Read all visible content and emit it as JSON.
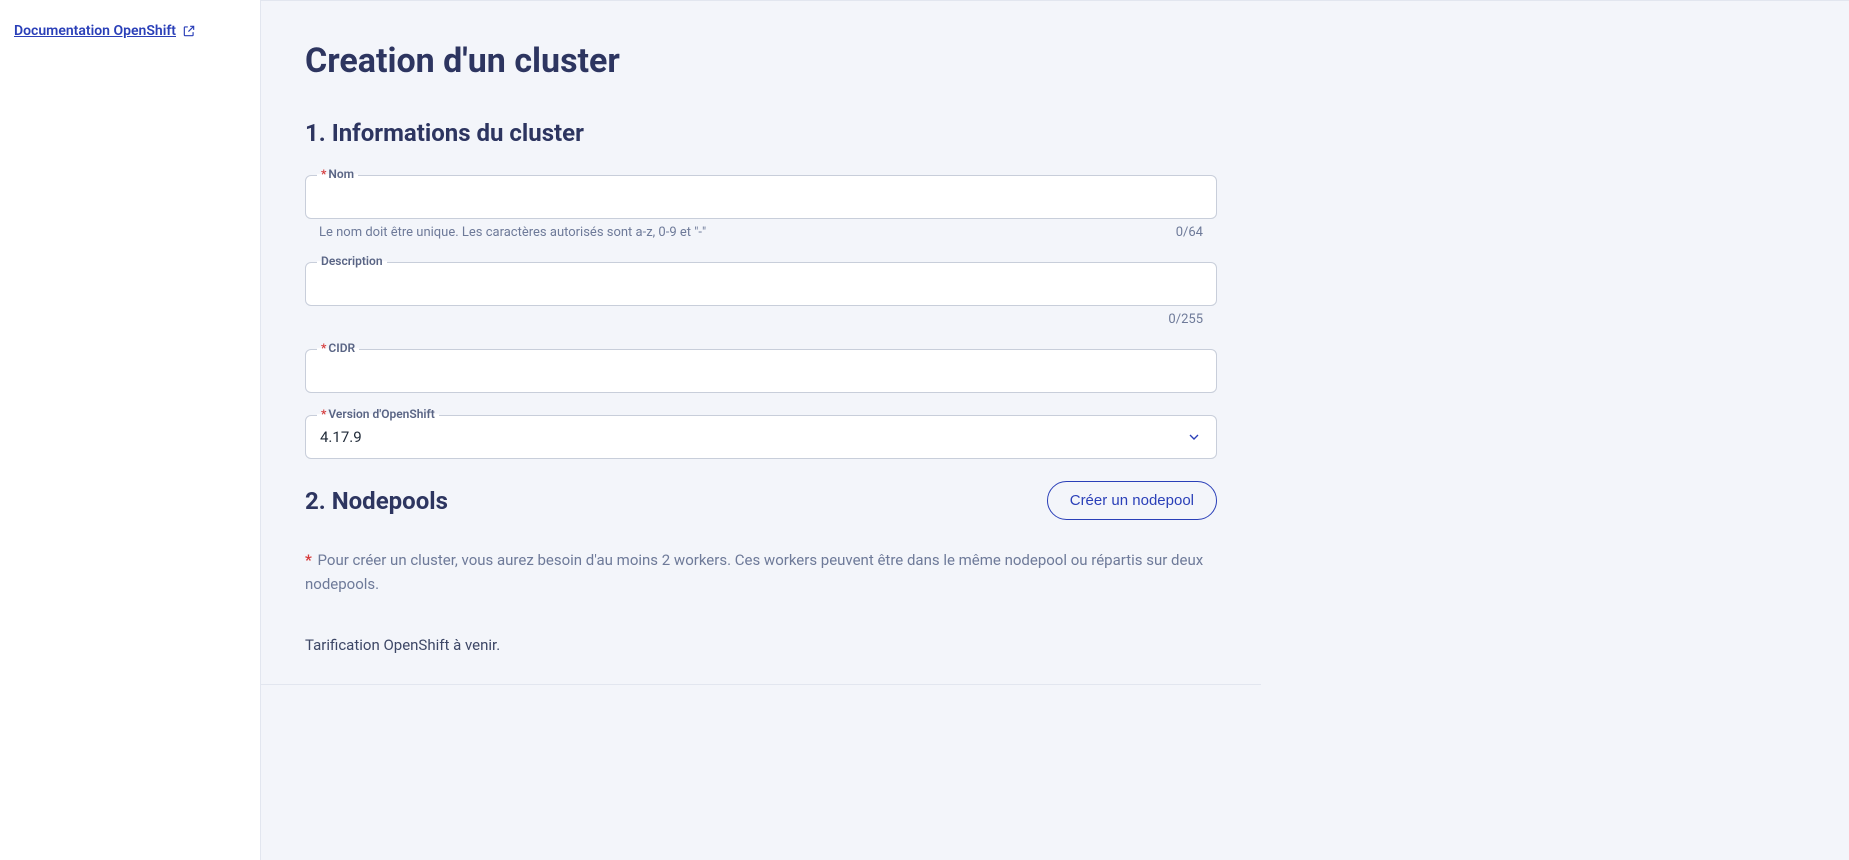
{
  "sidebar": {
    "doc_link_label": "Documentation OpenShift"
  },
  "page": {
    "title": "Creation d'un cluster"
  },
  "section1": {
    "title": "1. Informations du cluster",
    "fields": {
      "name": {
        "label": "Nom",
        "hint": "Le nom doit être unique. Les caractères autorisés sont a-z, 0-9 et \"-\"",
        "counter": "0/64"
      },
      "description": {
        "label": "Description",
        "counter": "0/255"
      },
      "cidr": {
        "label": "CIDR"
      },
      "version": {
        "label": "Version d'OpenShift",
        "value": "4.17.9"
      }
    }
  },
  "section2": {
    "title": "2. Nodepools",
    "create_button": "Créer un nodepool",
    "info": "Pour créer un cluster, vous aurez besoin d'au moins 2 workers. Ces workers peuvent être dans le même nodepool ou répartis sur deux nodepools."
  },
  "pricing": {
    "text": "Tarification OpenShift à venir."
  }
}
